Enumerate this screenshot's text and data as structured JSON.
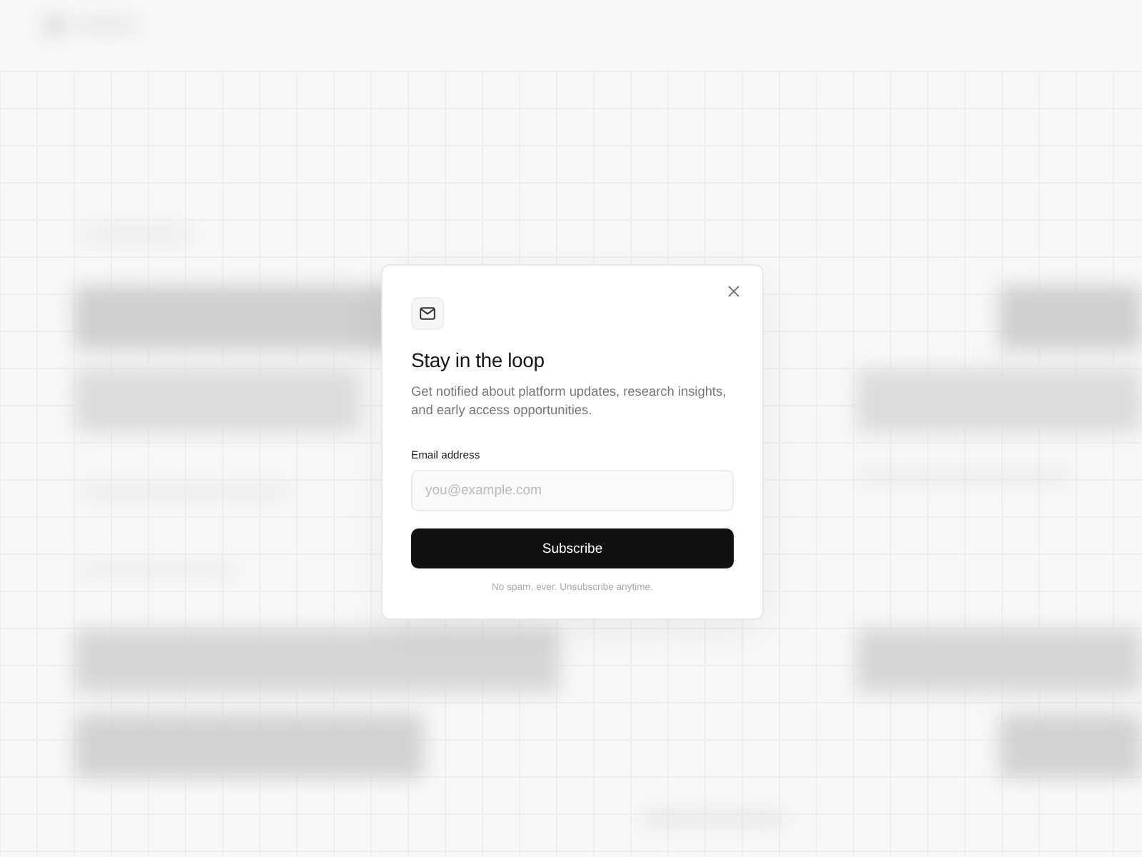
{
  "dialog": {
    "title": "Stay in the loop",
    "description": "Get notified about platform updates, research insights, and early access opportunities.",
    "email_field": {
      "label": "Email address",
      "placeholder": "you@example.com"
    },
    "submit_button": "Subscribe",
    "footnote": "No spam, ever. Unsubscribe anytime."
  }
}
